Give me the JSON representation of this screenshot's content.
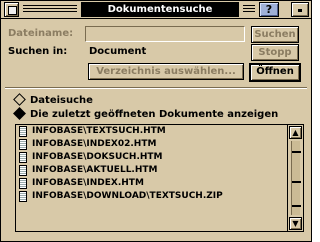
{
  "window": {
    "title": "Dokumentensuche",
    "help_label": "?"
  },
  "form": {
    "filename_label": "Dateiname:",
    "filename_value": "",
    "search_in_label": "Suchen in:",
    "search_in_value": "Document"
  },
  "buttons": {
    "search": "Suchen",
    "stop": "Stopp",
    "select_dir": "Verzeichnis auswählen...",
    "open": "Öffnen"
  },
  "options": {
    "file_search": "Dateisuche",
    "recent_docs": "Die zuletzt geöffneten Dokumente anzeigen",
    "selected": "recent_docs"
  },
  "list": {
    "items": [
      "INFOBASE\\TEXTSUCH.HTM",
      "INFOBASE\\INDEX02.HTM",
      "INFOBASE\\DOKSUCH.HTM",
      "INFOBASE\\AKTUELL.HTM",
      "INFOBASE\\INDEX.HTM",
      "INFOBASE\\DOWNLOAD\\TEXTSUCH.ZIP"
    ]
  },
  "colors": {
    "window_bg": "#d8c9a8",
    "title_bg": "#000000",
    "title_fg": "#ffffff",
    "help_button": "#9fb0d8",
    "disabled_text": "#8b7d62"
  },
  "icons": {
    "close": "close-box-icon",
    "help": "help-icon",
    "minimize": "minimize-icon",
    "document": "document-icon",
    "scroll_up": "scroll-up-arrow-icon",
    "scroll_down": "scroll-down-arrow-icon"
  }
}
